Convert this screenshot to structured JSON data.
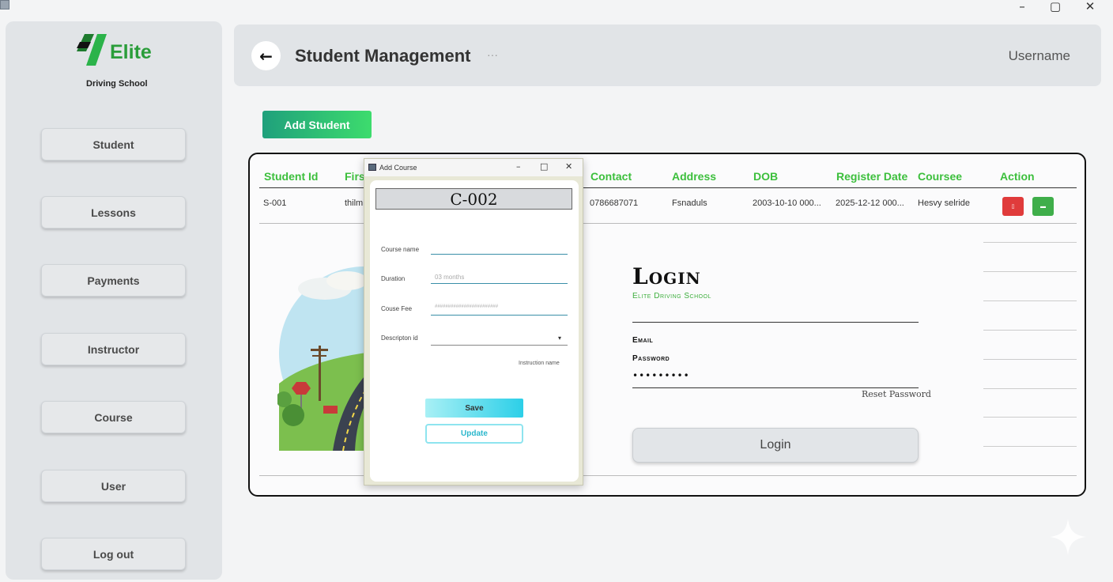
{
  "window": {
    "minimize": "–",
    "maximize": "▢",
    "close": "✕"
  },
  "logo": {
    "name": "Elite",
    "subtitle": "Driving School"
  },
  "sidebar": {
    "items": [
      {
        "label": "Student"
      },
      {
        "label": "Lessons"
      },
      {
        "label": "Payments"
      },
      {
        "label": "Instructor"
      },
      {
        "label": "Course"
      },
      {
        "label": "User"
      },
      {
        "label": "Log out"
      }
    ]
  },
  "header": {
    "back_icon": "←",
    "title": "Student Management",
    "more": "···",
    "username": "Username"
  },
  "toolbar": {
    "add_label": "Add Student"
  },
  "table": {
    "columns": [
      "Student Id",
      "First",
      "Contact",
      "Address",
      "DOB",
      "Register Date",
      "Coursee",
      "Action"
    ],
    "rows": [
      {
        "student_id": "S-001",
        "first": "thilmi",
        "contact": "0786687071",
        "address": "Fsnaduls",
        "dob": "2003-10-10 000...",
        "register_date": "2025-12-12 000...",
        "course": "Hesvy selride",
        "delete_glyph": "▯",
        "edit_glyph": "▬"
      }
    ]
  },
  "login": {
    "title": "Login",
    "subtitle": "Elite Driving School",
    "email_label": "Email",
    "password_label": "Password",
    "password_value": "•••••••••",
    "reset_label": "Reset Password",
    "button_label": "Login"
  },
  "modal": {
    "title": "Add Course",
    "minimize": "–",
    "maximize": "□",
    "close": "✕",
    "course_code": "C-002",
    "fields": {
      "course_name_label": "Course name",
      "duration_label": "Duration",
      "duration_placeholder": "03 months",
      "fee_label": "Couse Fee",
      "fee_placeholder": "########################",
      "description_label": "Descripton id",
      "caret": "▾"
    },
    "instructor_name": "Instruction name",
    "save_label": "Save",
    "update_label": "Update"
  },
  "colors": {
    "accent_green": "#3cbf3c",
    "add_button_gradient": [
      "#1fa07c",
      "#3ddc6d"
    ],
    "delete_red": "#e03b3b",
    "edit_green": "#3fae4a",
    "save_cyan": "#2ccfe8"
  }
}
